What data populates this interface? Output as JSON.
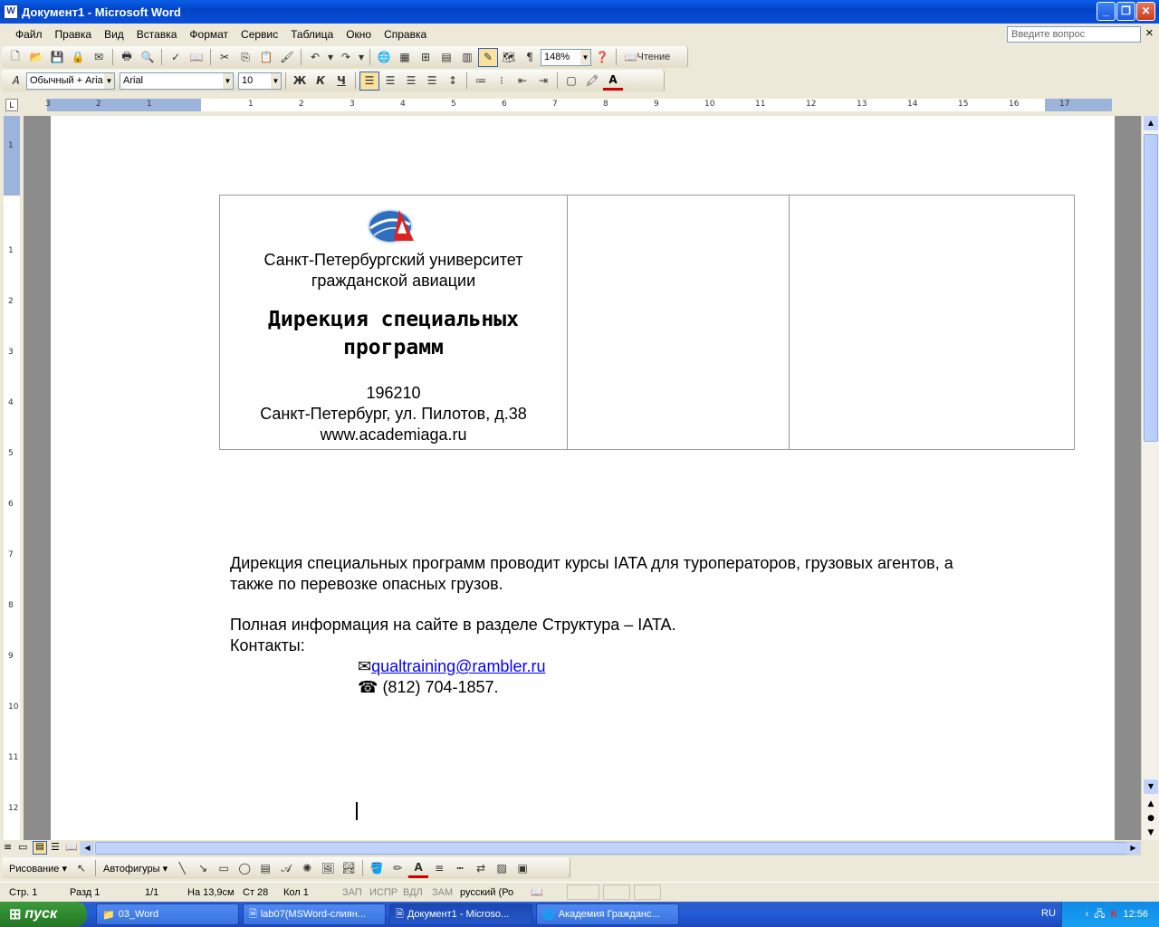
{
  "window": {
    "title": "Документ1 - Microsoft Word",
    "min": "_",
    "max": "❐",
    "close": "✕"
  },
  "menu": {
    "items": [
      "Файл",
      "Правка",
      "Вид",
      "Вставка",
      "Формат",
      "Сервис",
      "Таблица",
      "Окно",
      "Справка"
    ],
    "ask_placeholder": "Введите вопрос"
  },
  "standard_toolbar": {
    "zoom": "148%",
    "reading_label": "Чтение"
  },
  "formatting_toolbar": {
    "style": "Обычный + Aria",
    "font": "Arial",
    "size": "10",
    "bold": "Ж",
    "italic": "К",
    "underline": "Ч"
  },
  "ruler": {
    "labels": [
      "3",
      "2",
      "1",
      "1",
      "2",
      "3",
      "4",
      "5",
      "6",
      "7",
      "8",
      "9",
      "10",
      "11",
      "12",
      "13",
      "14",
      "15",
      "16",
      "17"
    ]
  },
  "vruler": {
    "labels": [
      "1",
      "1",
      "2",
      "3",
      "4",
      "5",
      "6",
      "7",
      "8",
      "9",
      "10",
      "11",
      "12"
    ]
  },
  "letterhead": {
    "org_line1": "Санкт-Петербургский университет",
    "org_line2": "гражданской авиации",
    "heading_line1": "Дирекция специальных",
    "heading_line2": "программ",
    "postal_code": "196210",
    "address": "Санкт-Петербург, ул. Пилотов, д.38",
    "website": "www.academiaga.ru"
  },
  "body": {
    "para1_line1": "Дирекция специальных программ проводит курсы IATA для туроператоров, грузовых агентов, а",
    "para1_line2": "также по перевозке опасных грузов.",
    "para2": "Полная информация на сайте в разделе Структура – IATA.",
    "contacts_label": "Контакты:",
    "email": "qualtraining@rambler.ru",
    "phone": "(812) 704-1857."
  },
  "drawing_toolbar": {
    "draw_label": "Рисование",
    "autoshapes_label": "Автофигуры"
  },
  "status": {
    "page": "Стр. 1",
    "section": "Разд 1",
    "pages": "1/1",
    "at": "На 13,9см",
    "line": "Ст 28",
    "col": "Кол 1",
    "rec": "ЗАП",
    "trk": "ИСПР",
    "ext": "ВДЛ",
    "ovr": "ЗАМ",
    "lang": "русский (Ро"
  },
  "taskbar": {
    "start": "пуск",
    "tasks": [
      "03_Word",
      "lab07(MSWord-слиян...",
      "Документ1 - Microso...",
      "Академия Гражданс..."
    ],
    "lang": "RU",
    "clock": "12:56"
  }
}
